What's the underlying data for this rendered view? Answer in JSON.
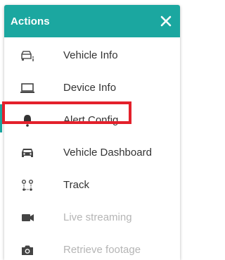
{
  "header": {
    "title": "Actions"
  },
  "colors": {
    "accent": "#1ba7a0",
    "highlight": "#e3202b"
  },
  "menu": {
    "items": [
      {
        "label": "Vehicle Info",
        "icon": "vehicle-info-icon",
        "enabled": true
      },
      {
        "label": "Device Info",
        "icon": "laptop-icon",
        "enabled": true
      },
      {
        "label": "Alert Config",
        "icon": "bell-icon",
        "enabled": true
      },
      {
        "label": "Vehicle Dashboard",
        "icon": "car-icon",
        "enabled": true
      },
      {
        "label": "Track",
        "icon": "route-icon",
        "enabled": true
      },
      {
        "label": "Live streaming",
        "icon": "video-camera-icon",
        "enabled": false
      },
      {
        "label": "Retrieve footage",
        "icon": "camera-icon",
        "enabled": false
      }
    ]
  }
}
